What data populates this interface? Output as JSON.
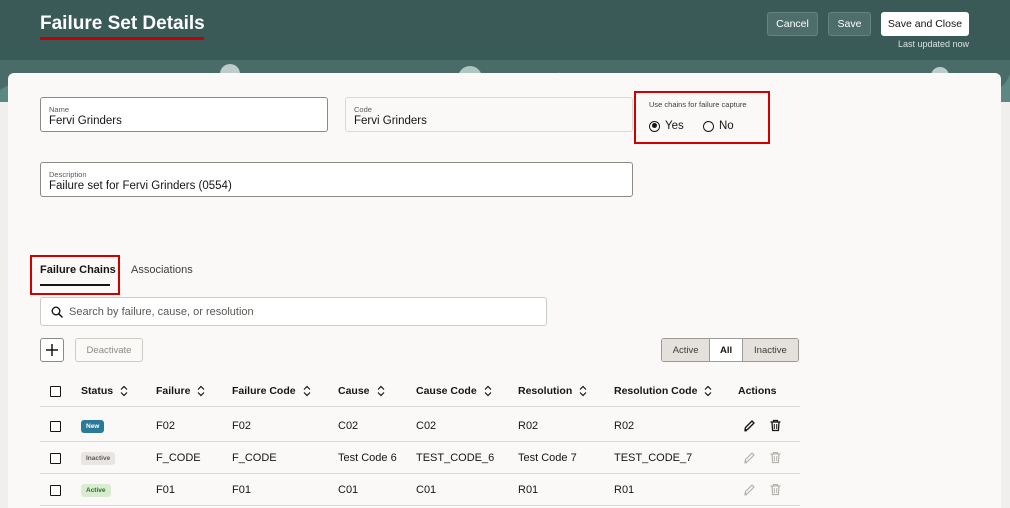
{
  "header": {
    "title": "Failure Set Details",
    "cancel_label": "Cancel",
    "save_label": "Save",
    "save_close_label": "Save and Close",
    "last_updated": "Last updated now"
  },
  "form": {
    "name_label": "Name",
    "name_value": "Fervi Grinders",
    "code_label": "Code",
    "code_value": "Fervi Grinders",
    "description_label": "Description",
    "description_value": "Failure set for Fervi Grinders (0554)",
    "chains": {
      "label": "Use chains for failure capture",
      "yes_label": "Yes",
      "no_label": "No",
      "selected": "Yes"
    }
  },
  "tabs": [
    {
      "label": "Failure Chains",
      "selected": true
    },
    {
      "label": "Associations",
      "selected": false
    }
  ],
  "toolbar": {
    "search_placeholder": "Search by failure, cause, or resolution",
    "deactivate_label": "Deactivate",
    "filters": [
      "Active",
      "All",
      "Inactive"
    ],
    "selected_filter": "All"
  },
  "table": {
    "columns": [
      "Status",
      "Failure",
      "Failure Code",
      "Cause",
      "Cause Code",
      "Resolution",
      "Resolution Code",
      "Actions"
    ],
    "rows": [
      {
        "status": "New",
        "failure": "F02",
        "failure_code": "F02",
        "cause": "C02",
        "cause_code": "C02",
        "resolution": "R02",
        "resolution_code": "R02"
      },
      {
        "status": "Inactive",
        "failure": "F_CODE",
        "failure_code": "F_CODE",
        "cause": "Test Code 6",
        "cause_code": "TEST_CODE_6",
        "resolution": "Test Code 7",
        "resolution_code": "TEST_CODE_7"
      },
      {
        "status": "Active",
        "failure": "F01",
        "failure_code": "F01",
        "cause": "C01",
        "cause_code": "C01",
        "resolution": "R01",
        "resolution_code": "R01"
      }
    ]
  },
  "colors": {
    "header_bg": "#3a5a57",
    "highlight_red": "#d00000",
    "badge_new": "#2a7a9a",
    "badge_active": "#d8ecd0"
  }
}
